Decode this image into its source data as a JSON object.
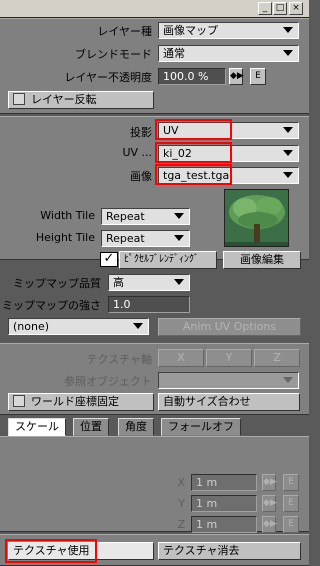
{
  "window": {
    "min_glyph": "_",
    "max_glyph": "□",
    "close_glyph": "×"
  },
  "layer": {
    "type_label": "レイヤー種",
    "type_value": "画像マップ",
    "blend_label": "ブレンドモード",
    "blend_value": "通常",
    "opacity_label": "レイヤー不透明度",
    "opacity_value": "100.0 %",
    "env_label": "E",
    "invert_label": "レイヤー反転"
  },
  "mapping": {
    "projection_label": "投影",
    "projection_value": "UV",
    "uv_label": "UV ...",
    "uv_value": "ki_02",
    "image_label": "画像",
    "image_value": "tga_test.tga",
    "width_tile_label": "Width Tile",
    "width_tile_value": "Repeat",
    "height_tile_label": "Height Tile",
    "height_tile_value": "Repeat",
    "pixel_blend_label": "ﾋﾟｸｾﾙﾌﾞﾚﾝﾃﾞｨﾝｸﾞ",
    "pixel_blend_checked": true,
    "image_edit_label": "画像編集",
    "mip_quality_label": "ミップマップ品質",
    "mip_quality_value": "高",
    "mip_strength_label": "ミップマップの強さ",
    "mip_strength_value": "1.0",
    "anim_value": "(none)",
    "anim_uv_label": "Anim UV Options"
  },
  "axis": {
    "axis_label": "テクスチャ軸",
    "x": "X",
    "y": "Y",
    "z": "Z",
    "ref_label": "参照オブジェクト",
    "world_coords_label": "ワールド座標固定",
    "auto_size_label": "自動サイズ合わせ"
  },
  "tabs": [
    "スケール",
    "位置",
    "角度",
    "フォールオフ"
  ],
  "scale": {
    "x_label": "X",
    "x_value": "1 m",
    "y_label": "Y",
    "y_value": "1 m",
    "z_label": "Z",
    "z_value": "1 m",
    "env_label": "E"
  },
  "footer": {
    "use_label": "テクスチャ使用",
    "clear_label": "テクスチャ消去"
  },
  "colors": {
    "highlight": "#ff0000",
    "panel": "#808080"
  }
}
